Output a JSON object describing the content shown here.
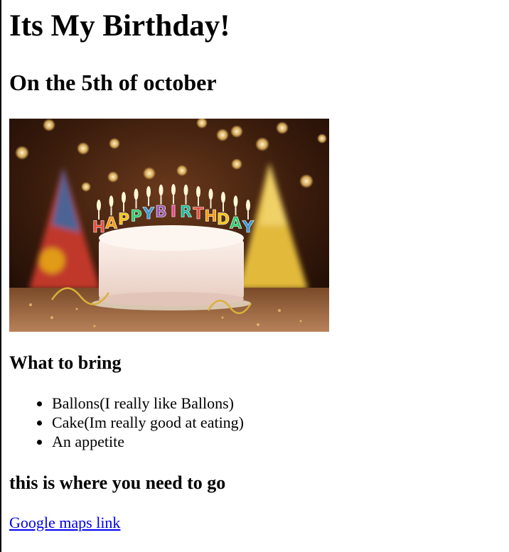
{
  "page": {
    "title": "Its My Birthday!",
    "subtitle": "On the 5th of october"
  },
  "image": {
    "candle_letters": [
      "H",
      "A",
      "P",
      "P",
      "Y",
      "B",
      "I",
      "R",
      "T",
      "H",
      "D",
      "A",
      "Y"
    ],
    "colors": {
      "background_dark": "#2a1208",
      "bokeh": "#f7c96a",
      "cake": "#f3e4dc",
      "plate": "#d8c6b0",
      "hat_left": "#c0392b",
      "hat_right": "#e2b93b"
    }
  },
  "bring": {
    "heading": "What to bring",
    "items": [
      "Ballons(I really like Ballons)",
      "Cake(Im really good at eating)",
      "An appetite"
    ]
  },
  "directions": {
    "heading": "this is where you need to go",
    "link_text": "Google maps link",
    "link_color": "#0000ee"
  }
}
